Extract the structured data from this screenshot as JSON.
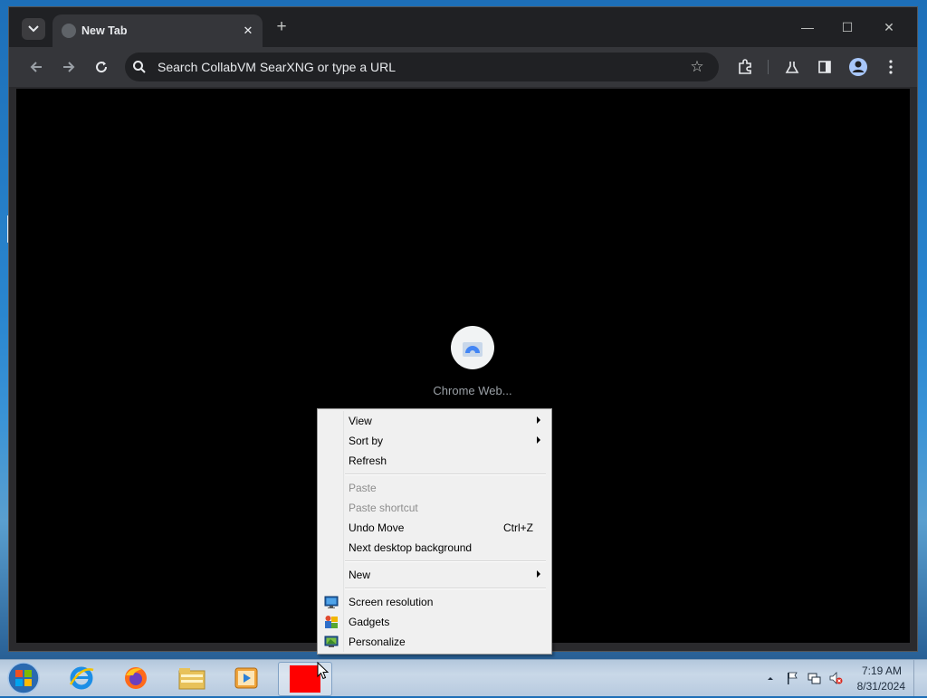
{
  "browser": {
    "tab_title": "New Tab",
    "omnibox_placeholder": "Search CollabVM SearXNG or type a URL",
    "shortcut_label": "Chrome Web..."
  },
  "context_menu": {
    "items": [
      {
        "label": "View",
        "submenu": true,
        "enabled": true
      },
      {
        "label": "Sort by",
        "submenu": true,
        "enabled": true
      },
      {
        "label": "Refresh",
        "enabled": true
      },
      {
        "label": "Paste",
        "enabled": false
      },
      {
        "label": "Paste shortcut",
        "enabled": false
      },
      {
        "label": "Undo Move",
        "shortcut": "Ctrl+Z",
        "enabled": true
      },
      {
        "label": "Next desktop background",
        "enabled": true
      },
      {
        "label": "New",
        "submenu": true,
        "enabled": true
      },
      {
        "label": "Screen resolution",
        "icon": "screen-resolution-icon",
        "enabled": true
      },
      {
        "label": "Gadgets",
        "icon": "gadgets-icon",
        "enabled": true
      },
      {
        "label": "Personalize",
        "icon": "personalize-icon",
        "enabled": true
      }
    ]
  },
  "taskbar": {
    "apps": [
      "internet-explorer-icon",
      "firefox-icon",
      "file-explorer-icon",
      "media-player-icon",
      "red-app-icon"
    ],
    "clock_time": "7:19 AM",
    "clock_date": "8/31/2024"
  },
  "colors": {
    "chrome_frame": "#202124",
    "chrome_toolbar": "#35363a",
    "content_bg": "#000000",
    "menu_bg": "#f0f0f0",
    "red_app": "#ff0000"
  }
}
